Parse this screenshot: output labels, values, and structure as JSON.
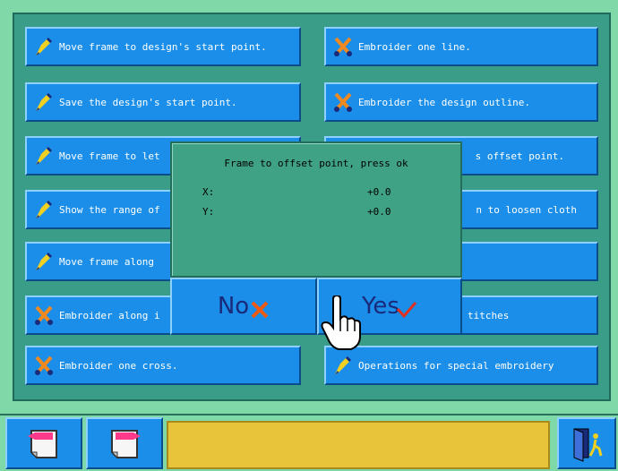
{
  "menu": {
    "left": [
      {
        "label": "Move frame to design's start point.",
        "icon": "pen-icon"
      },
      {
        "label": "Save the design's start point.",
        "icon": "pen-icon"
      },
      {
        "label": "Move frame to let",
        "icon": "pen-icon"
      },
      {
        "label": "Show the range of",
        "icon": "pen-icon"
      },
      {
        "label": "Move frame along",
        "icon": "pen-icon"
      },
      {
        "label": "Embroider along i",
        "icon": "scissors-icon"
      },
      {
        "label": "Embroider one cross.",
        "icon": "scissors-icon"
      }
    ],
    "right": [
      {
        "label": "Embroider one line.",
        "icon": "scissors-icon"
      },
      {
        "label": "Embroider the design outline.",
        "icon": "scissors-icon"
      },
      {
        "label": "s offset point.",
        "icon": "pen-icon"
      },
      {
        "label": "n to loosen cloth",
        "icon": "pen-icon"
      },
      {
        "label": "",
        "icon": ""
      },
      {
        "label": "titches",
        "icon": ""
      },
      {
        "label": "Operations for special embroidery",
        "icon": "pen-icon"
      }
    ]
  },
  "dialog": {
    "title": "Frame to offset point, press ok",
    "x_label": "X:",
    "x_value": "+0.0",
    "y_label": "Y:",
    "y_value": "+0.0",
    "no_label": "No",
    "yes_label": "Yes"
  },
  "colors": {
    "button_blue": "#1a8ee8",
    "panel_green": "#3a9d88",
    "status_yellow": "#e8c43a"
  }
}
